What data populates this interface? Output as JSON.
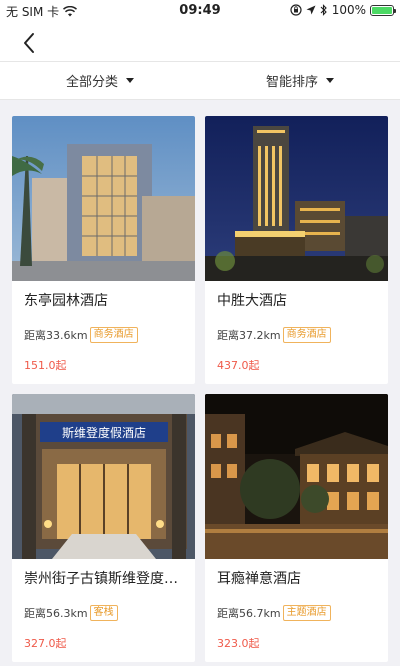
{
  "status_bar": {
    "carrier": "无 SIM 卡",
    "time": "09:49",
    "battery": "100%",
    "battery_level": 1.0
  },
  "nav": {
    "back_icon": "chevron-left-icon"
  },
  "filters": {
    "category_label": "全部分类",
    "sort_label": "智能排序"
  },
  "hotels": [
    {
      "name": "东亭园林酒店",
      "distance": "距离33.6km",
      "tag": "商务酒店",
      "price": "151.0起"
    },
    {
      "name": "中胜大酒店",
      "distance": "距离37.2km",
      "tag": "商务酒店",
      "price": "437.0起"
    },
    {
      "name": "崇州街子古镇斯维登度假酒店",
      "distance": "距离56.3km",
      "tag": "客栈",
      "price": "327.0起",
      "sign_text": "斯维登度假酒店"
    },
    {
      "name": "耳瘾禅意酒店",
      "distance": "距离56.7km",
      "tag": "主题酒店",
      "price": "323.0起"
    }
  ],
  "colors": {
    "price": "#ef5a4a",
    "tag": "#e89a2a",
    "background": "#f1f1f5"
  }
}
